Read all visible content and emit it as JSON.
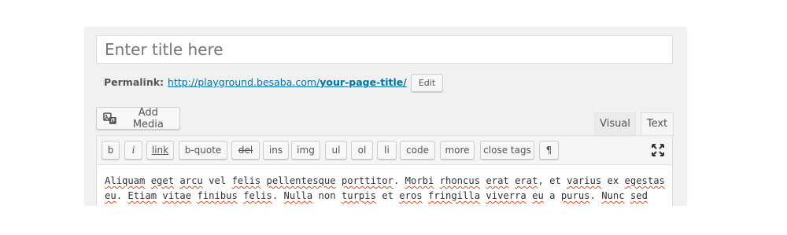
{
  "title": {
    "placeholder": "Enter title here"
  },
  "permalink": {
    "label": "Permalink:",
    "url_base": "http://playground.besaba.com/",
    "url_slug": "your-page-title/",
    "edit_label": "Edit"
  },
  "media": {
    "add_media_label": "Add Media",
    "icon": "media-upload-icon"
  },
  "tabs": [
    {
      "label": "Visual",
      "active": false
    },
    {
      "label": "Text",
      "active": true
    }
  ],
  "toolbar": {
    "buttons": [
      "b",
      "i",
      "link",
      "b-quote",
      "del",
      "ins",
      "img",
      "ul",
      "ol",
      "li",
      "code",
      "more",
      "close tags",
      "¶"
    ],
    "fullscreen_icon": "fullscreen-icon"
  },
  "editor": {
    "line1": [
      "Aliquam",
      " ",
      "eget",
      " ",
      "arcu",
      " vel ",
      "felis",
      " ",
      "pellentesque",
      " ",
      "porttitor",
      ". ",
      "Morbi",
      " ",
      "rhoncus",
      " ",
      "erat",
      " ",
      "erat",
      ", et ",
      "varius",
      " ex ",
      "egestas"
    ],
    "line2": [
      "eu",
      ". ",
      "Etiam",
      " ",
      "vitae",
      " ",
      "finibus",
      " ",
      "felis",
      ". ",
      "Nulla",
      " non ",
      "turpis",
      " et ",
      "eros",
      " ",
      "fringilla",
      " ",
      "viverra",
      " ",
      "eu",
      " a ",
      "purus",
      ". ",
      "Nunc",
      " ",
      "sed"
    ]
  },
  "colors": {
    "link": "#0073aa",
    "spellcheck": "#d54e21",
    "panel_bg": "#f1f1f1"
  }
}
